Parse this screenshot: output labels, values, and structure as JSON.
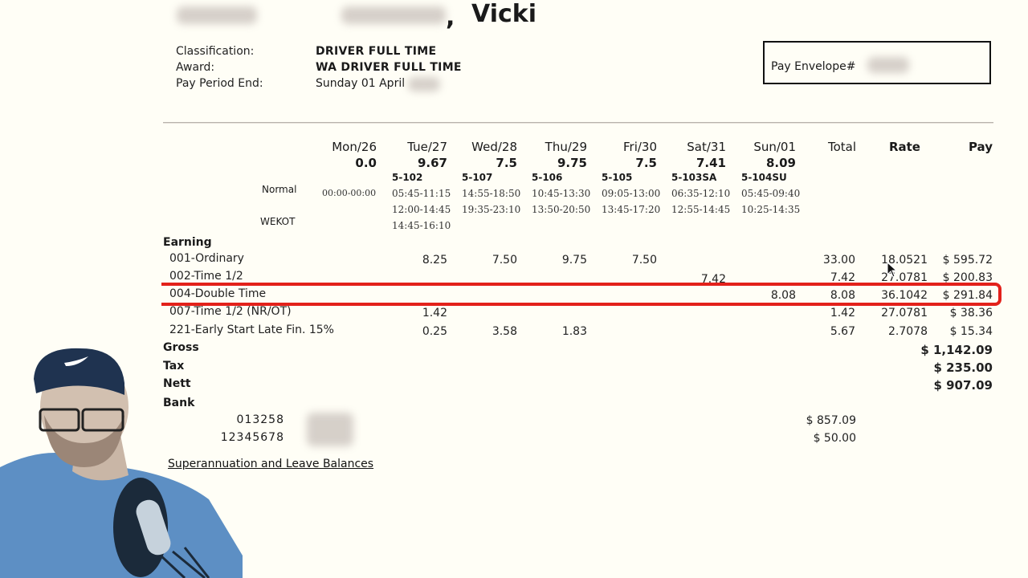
{
  "employee": {
    "surname_redacted": true,
    "middle_redacted": true,
    "first_name": "Vicki",
    "comma": ","
  },
  "info": {
    "classification_label": "Classification:",
    "classification_value": "DRIVER FULL TIME",
    "award_label": "Award:",
    "award_value": "WA DRIVER FULL TIME",
    "period_label": "Pay Period End:",
    "period_value": "Sunday 01 April"
  },
  "envelope": {
    "label": "Pay Envelope#"
  },
  "days": [
    {
      "day": "Mon/26",
      "hours": "0.0",
      "code": "",
      "times": [
        "00:00-00:00"
      ]
    },
    {
      "day": "Tue/27",
      "hours": "9.67",
      "code": "5-102",
      "times": [
        "05:45-11:15",
        "12:00-14:45",
        "14:45-16:10"
      ]
    },
    {
      "day": "Wed/28",
      "hours": "7.5",
      "code": "5-107",
      "times": [
        "14:55-18:50",
        "19:35-23:10"
      ]
    },
    {
      "day": "Thu/29",
      "hours": "9.75",
      "code": "5-106",
      "times": [
        "10:45-13:30",
        "13:50-20:50"
      ]
    },
    {
      "day": "Fri/30",
      "hours": "7.5",
      "code": "5-105",
      "times": [
        "09:05-13:00",
        "13:45-17:20"
      ]
    },
    {
      "day": "Sat/31",
      "hours": "7.41",
      "code": "5-103SA",
      "times": [
        "06:35-12:10",
        "12:55-14:45"
      ]
    },
    {
      "day": "Sun/01",
      "hours": "8.09",
      "code": "5-104SU",
      "times": [
        "05:45-09:40",
        "10:25-14:35"
      ]
    }
  ],
  "row_labels": {
    "normal": "Normal",
    "wekot": "WEKOT"
  },
  "headers": {
    "total": "Total",
    "rate": "Rate",
    "pay": "Pay"
  },
  "sections": {
    "earning": "Earning",
    "gross": "Gross",
    "tax": "Tax",
    "nett": "Nett",
    "bank": "Bank"
  },
  "earnings": [
    {
      "label": "001-Ordinary",
      "tue": "8.25",
      "wed": "7.50",
      "thu": "9.75",
      "fri": "7.50",
      "sat": "",
      "sun": "",
      "total": "33.00",
      "rate": "18.0521",
      "pay": "$ 595.72"
    },
    {
      "label": "002-Time 1/2",
      "tue": "",
      "wed": "",
      "thu": "",
      "fri": "",
      "sat": "7.42",
      "sun": "",
      "total": "7.42",
      "rate": "27.0781",
      "pay": "$ 200.83"
    },
    {
      "label": "004-Double Time",
      "tue": "",
      "wed": "",
      "thu": "",
      "fri": "",
      "sat": "",
      "sun": "8.08",
      "total": "8.08",
      "rate": "36.1042",
      "pay": "$ 291.84",
      "highlighted": true
    },
    {
      "label": "007-Time 1/2 (NR/OT)",
      "tue": "1.42",
      "wed": "",
      "thu": "",
      "fri": "",
      "sat": "",
      "sun": "",
      "total": "1.42",
      "rate": "27.0781",
      "pay": "$ 38.36"
    },
    {
      "label": "221-Early Start Late Fin. 15%",
      "tue": "0.25",
      "wed": "3.58",
      "thu": "1.83",
      "fri": "",
      "sat": "",
      "sun": "",
      "total": "5.67",
      "rate": "2.7078",
      "pay": "$ 15.34"
    }
  ],
  "totals": {
    "gross": "$ 1,142.09",
    "tax": "$ 235.00",
    "nett": "$ 907.09"
  },
  "bank": [
    {
      "bsb": "013258",
      "amount": "$ 857.09"
    },
    {
      "bsb": "12345678",
      "amount": "$ 50.00"
    }
  ],
  "links": {
    "super": "Superannuation and Leave Balances"
  },
  "colors": {
    "highlight": "#e3211b",
    "background": "#fffef6"
  }
}
